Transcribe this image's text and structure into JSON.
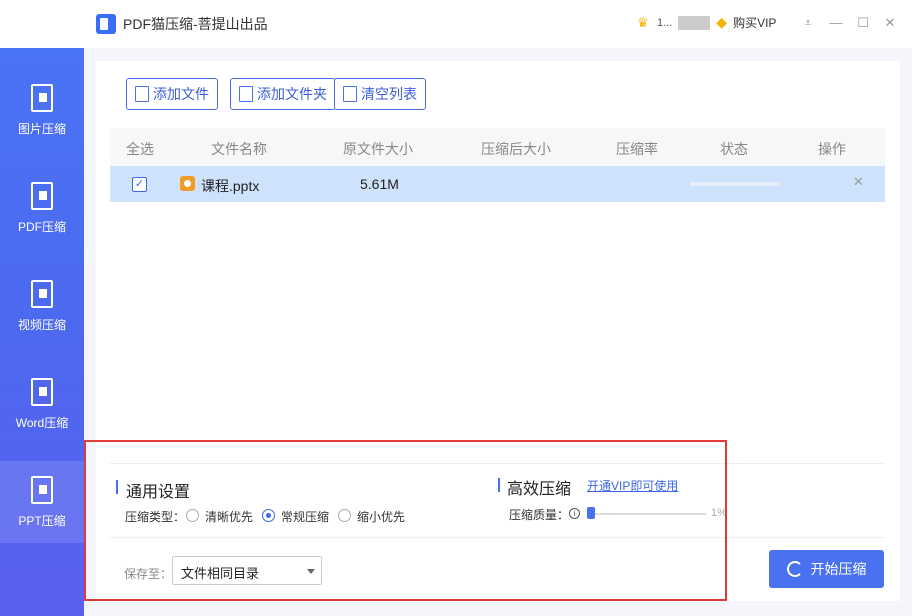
{
  "window": {
    "title": "PDF猫压缩-菩提山出品",
    "user_name": "1...",
    "buy_vip": "购买VIP"
  },
  "sidebar": {
    "items": [
      {
        "label": "图片压缩"
      },
      {
        "label": "PDF压缩"
      },
      {
        "label": "视频压缩"
      },
      {
        "label": "Word压缩"
      },
      {
        "label": "PPT压缩",
        "active": true
      }
    ]
  },
  "toolbar": {
    "add_file": "添加文件",
    "add_folder": "添加文件夹",
    "clear_list": "清空列表"
  },
  "table": {
    "headers": [
      "全选",
      "文件名称",
      "原文件大小",
      "压缩后大小",
      "压缩率",
      "状态",
      "操作"
    ],
    "rows": [
      {
        "checked": true,
        "name": "课程.pptx",
        "original_size": "5.61M",
        "compressed_size": "",
        "ratio": "",
        "status_progress": 0
      }
    ]
  },
  "settings": {
    "general_title": "通用设置",
    "type_label": "压缩类型：",
    "options": [
      "清晰优先",
      "常规压缩",
      "缩小优先"
    ],
    "selected": "常规压缩",
    "efficient_title": "高效压缩",
    "vip_link": "开通VIP即可使用",
    "quality_label": "压缩质量：",
    "quality_value": "1%",
    "save_label": "保存至：",
    "save_value": "文件相同目录"
  },
  "actions": {
    "start": "开始压缩"
  },
  "colors": {
    "accent": "#4a72f0",
    "highlight_row": "#cfe2fb",
    "annotation_border": "#e03a3a"
  }
}
